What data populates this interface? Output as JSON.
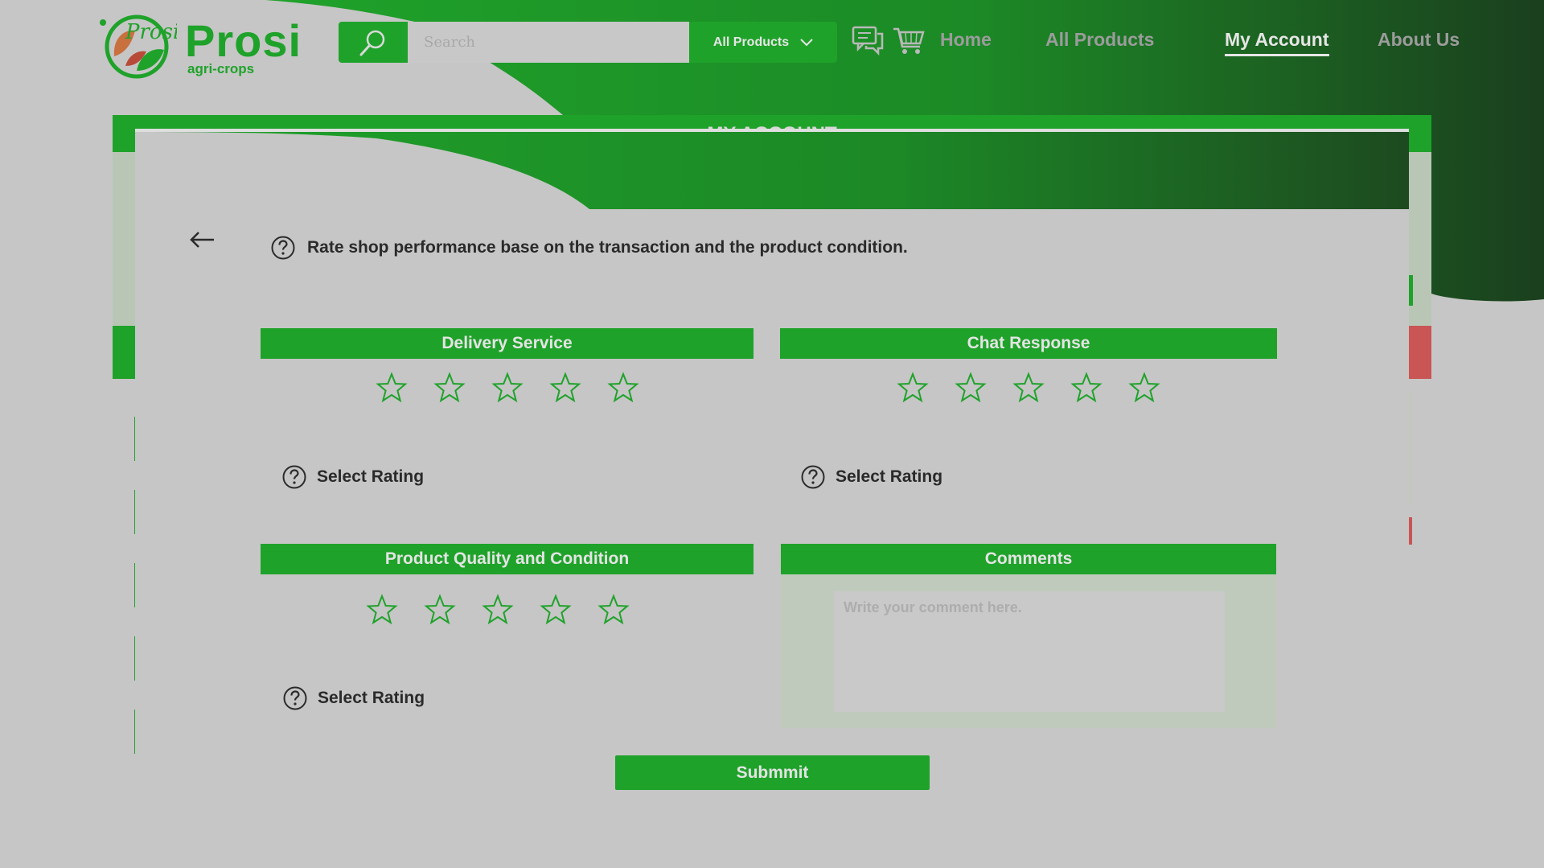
{
  "brand": {
    "name": "Prosi",
    "tagline": "agri-crops",
    "logo_text": "Prosi",
    "color": "#1fa22a"
  },
  "header": {
    "search_placeholder": "Search",
    "category_select": "All Products",
    "icons": [
      "search-icon",
      "chat-icon",
      "cart-icon",
      "chevron-down-icon"
    ],
    "nav": [
      {
        "label": "Home",
        "active": false
      },
      {
        "label": "All Products",
        "active": false
      },
      {
        "label": "My Account",
        "active": true
      },
      {
        "label": "About Us",
        "active": false
      }
    ]
  },
  "page": {
    "title": "MY ACCOUNT"
  },
  "rating_modal": {
    "instruction": "Rate shop performance base on the transaction and the product condition.",
    "cards": [
      {
        "title": "Delivery Service",
        "stars": 5,
        "rating": 0,
        "status": "Select Rating"
      },
      {
        "title": "Chat Response",
        "stars": 5,
        "rating": 0,
        "status": "Select Rating"
      },
      {
        "title": "Product Quality and Condition",
        "stars": 5,
        "rating": 0,
        "status": "Select Rating"
      }
    ],
    "comments": {
      "title": "Comments",
      "placeholder": "Write your comment here.",
      "value": ""
    },
    "submit_label": "Submmit"
  },
  "colors": {
    "primary": "#1fa22a",
    "dark_green": "#1d4a20",
    "danger": "#c95555",
    "overlay_bg": "#c6c6c6"
  }
}
